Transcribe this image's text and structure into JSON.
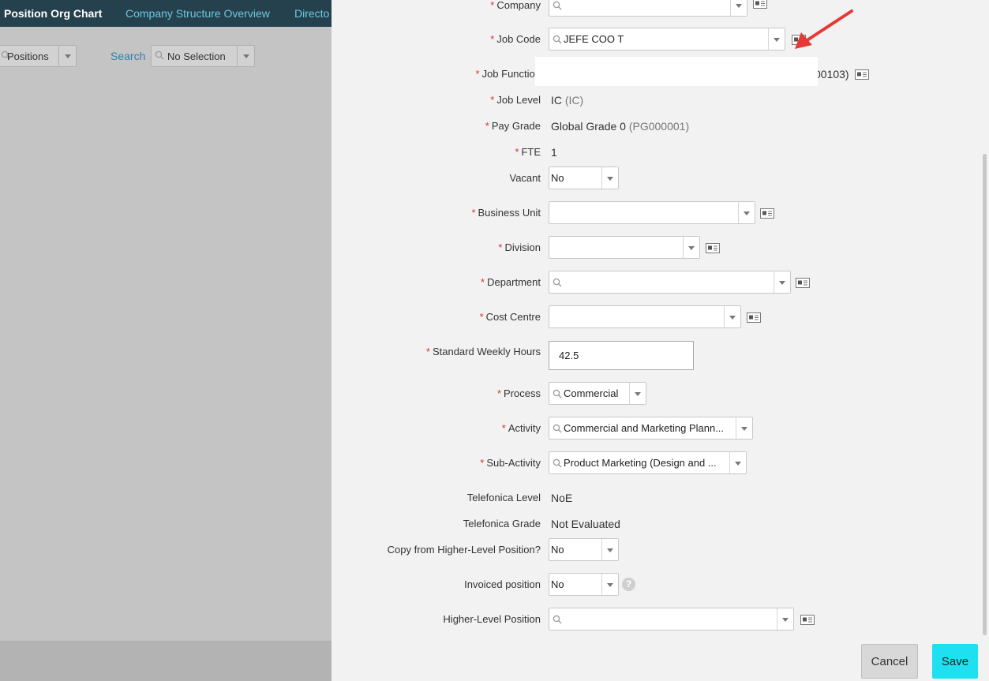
{
  "background": {
    "nav": {
      "active": "Position Org Chart",
      "link1": "Company Structure Overview",
      "link2": "Directo"
    },
    "filter_value": "Positions",
    "search_label": "Search",
    "search_value": "No Selection"
  },
  "form": {
    "company": {
      "label": "Company",
      "value": ""
    },
    "job_code": {
      "label": "Job Code",
      "value": "JEFE COO T"
    },
    "job_function": {
      "label": "Job Function",
      "value": "00103)"
    },
    "job_level": {
      "label": "Job Level",
      "value": "IC",
      "code": "(IC)"
    },
    "pay_grade": {
      "label": "Pay Grade",
      "value": "Global Grade 0",
      "code": "(PG000001)"
    },
    "fte": {
      "label": "FTE",
      "value": "1"
    },
    "vacant": {
      "label": "Vacant",
      "value": "No"
    },
    "business_unit": {
      "label": "Business Unit",
      "value": ""
    },
    "division": {
      "label": "Division",
      "value": ""
    },
    "department": {
      "label": "Department",
      "value": ""
    },
    "cost_centre": {
      "label": "Cost Centre",
      "value": ""
    },
    "standard_weekly_hours": {
      "label": "Standard Weekly Hours",
      "value": "42.5"
    },
    "process": {
      "label": "Process",
      "value": "Commercial"
    },
    "activity": {
      "label": "Activity",
      "value": "Commercial and Marketing Plann..."
    },
    "sub_activity": {
      "label": "Sub-Activity",
      "value": "Product Marketing (Design and ..."
    },
    "telefonica_level": {
      "label": "Telefonica Level",
      "value": "NoE"
    },
    "telefonica_grade": {
      "label": "Telefonica Grade",
      "value": "Not Evaluated"
    },
    "copy_from_higher": {
      "label": "Copy from Higher-Level Position?",
      "value": "No"
    },
    "invoiced_position": {
      "label": "Invoiced position",
      "value": "No",
      "help": "?"
    },
    "higher_level_position": {
      "label": "Higher-Level Position",
      "value": ""
    }
  },
  "buttons": {
    "cancel": "Cancel",
    "save": "Save"
  },
  "colors": {
    "nav_bg": "#25414e",
    "required": "#d9322b",
    "save_bg": "#1ee0f0",
    "annotation_arrow": "#e53935"
  }
}
